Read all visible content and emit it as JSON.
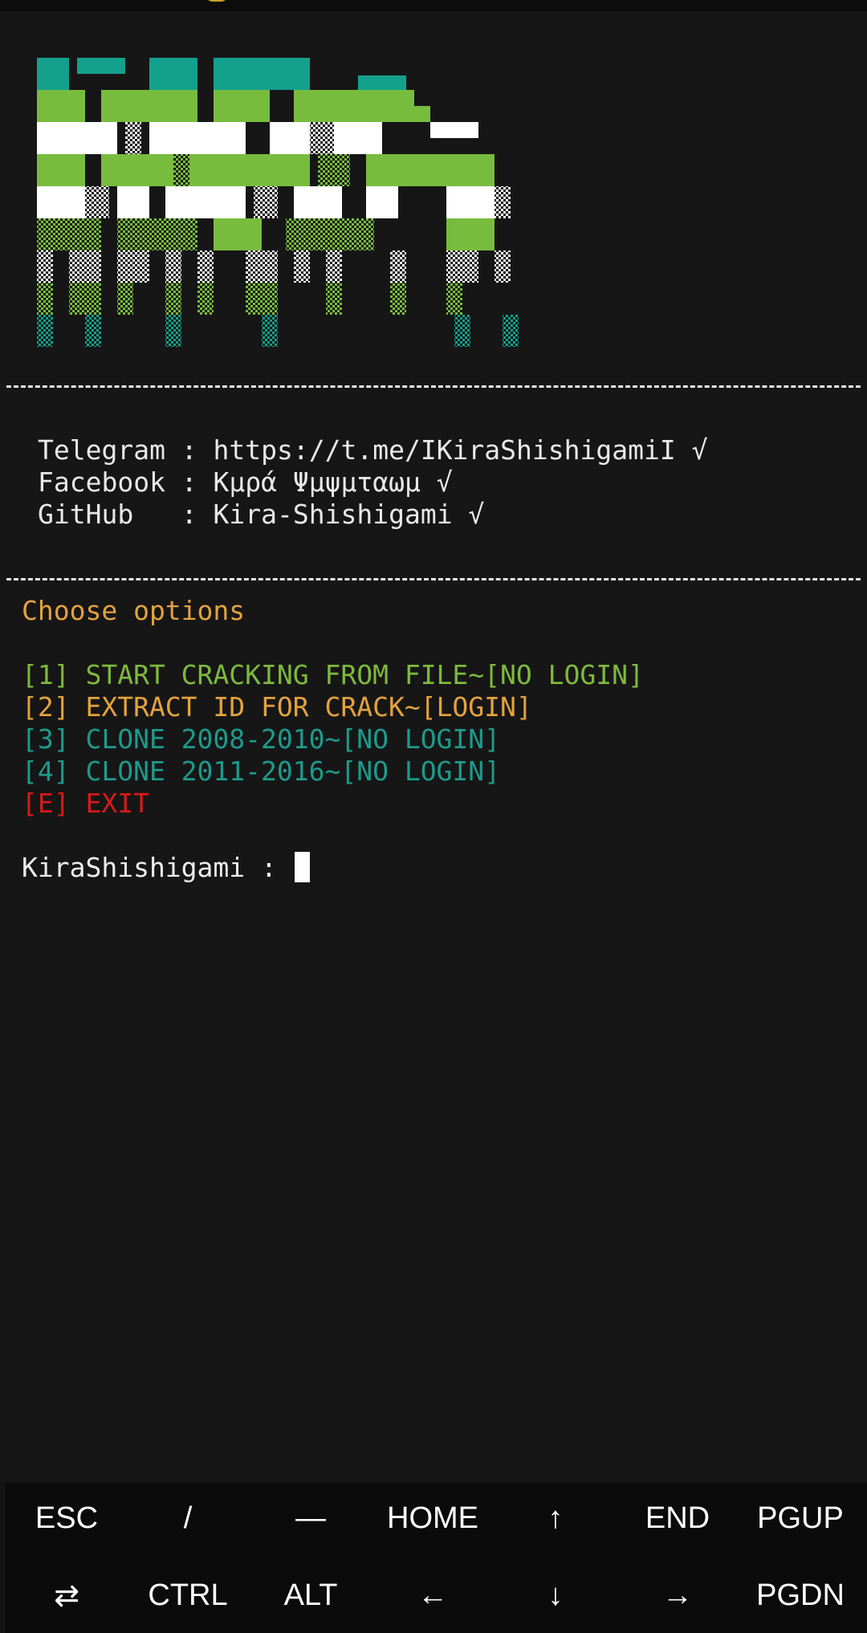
{
  "terminal": {
    "info_lines": [
      "Telegram : https://t.me/IKiraShishigamiI √",
      "Facebook : Κμρά Ψμψμταωμ √",
      "GitHub   : Kira-Shishigami √"
    ],
    "choose_label": "Choose options",
    "options": [
      {
        "text": "[1] START CRACKING FROM FILE~[NO LOGIN]",
        "color": "#7fb93c"
      },
      {
        "text": "[2] EXTRACT ID FOR CRACK~[LOGIN]",
        "color": "#e4a23d"
      },
      {
        "text": "[3] CLONE 2008-2010~[NO LOGIN]",
        "color": "#1d9a8c"
      },
      {
        "text": "[4] CLONE 2011-2016~[NO LOGIN]",
        "color": "#1d9a8c"
      },
      {
        "text": "[E] EXIT",
        "color": "#d71a1a"
      }
    ],
    "prompt": "KiraShishigami : ",
    "banner_colors": {
      "teal": "#13a08d",
      "green": "#78bc3e",
      "white": "#ffffff"
    }
  },
  "extra_keys": {
    "row1": [
      "ESC",
      "/",
      "—",
      "HOME",
      "↑",
      "END",
      "PGUP"
    ],
    "row2": [
      "⇄",
      "CTRL",
      "ALT",
      "←",
      "↓",
      "→",
      "PGDN"
    ]
  }
}
